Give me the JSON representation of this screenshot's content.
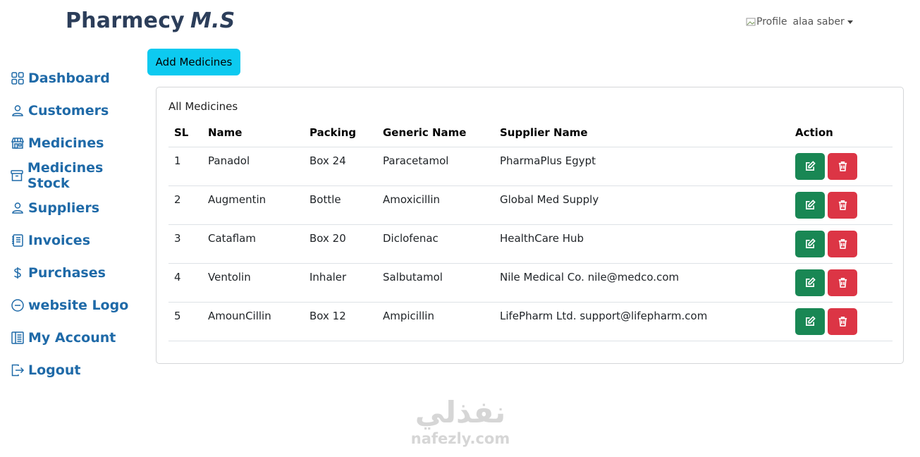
{
  "brand": {
    "name": "Pharmecy",
    "suffix": "M.S"
  },
  "profile": {
    "image_alt": "Profile",
    "username": "alaa saber"
  },
  "sidebar": {
    "items": [
      {
        "label": "Dashboard",
        "icon": "dashboard-grid-icon"
      },
      {
        "label": "Customers",
        "icon": "person-icon"
      },
      {
        "label": "Medicines",
        "icon": "shop-icon"
      },
      {
        "label": "Medicines Stock",
        "icon": "archive-icon"
      },
      {
        "label": "Suppliers",
        "icon": "person-icon"
      },
      {
        "label": "Invoices",
        "icon": "journal-icon"
      },
      {
        "label": "Purchases",
        "icon": "dollar-icon"
      },
      {
        "label": "website Logo",
        "icon": "dash-circle-icon"
      },
      {
        "label": "My Account",
        "icon": "layout-icon"
      },
      {
        "label": "Logout",
        "icon": "logout-icon"
      }
    ]
  },
  "toolbar": {
    "add_label": "Add Medicines"
  },
  "card": {
    "title": "All Medicines"
  },
  "table": {
    "headers": [
      "SL",
      "Name",
      "Packing",
      "Generic Name",
      "Supplier Name",
      "Action"
    ],
    "rows": [
      {
        "sl": "1",
        "name": "Panadol",
        "packing": "Box 24",
        "generic": "Paracetamol",
        "supplier": "PharmaPlus Egypt"
      },
      {
        "sl": "2",
        "name": "Augmentin",
        "packing": "Bottle",
        "generic": "Amoxicillin",
        "supplier": "Global Med Supply"
      },
      {
        "sl": "3",
        "name": "Cataflam",
        "packing": "Box 20",
        "generic": "Diclofenac",
        "supplier": "HealthCare Hub"
      },
      {
        "sl": "4",
        "name": "Ventolin",
        "packing": "Inhaler",
        "generic": "Salbutamol",
        "supplier": "Nile Medical Co. nile@medco.com"
      },
      {
        "sl": "5",
        "name": "AmounCillin",
        "packing": "Box 12",
        "generic": "Ampicillin",
        "supplier": "LifePharm Ltd. support@lifepharm.com"
      }
    ]
  },
  "colors": {
    "brand": "#2c3e5a",
    "nav": "#1f6aa8",
    "add_button": "#0dcaf0",
    "edit": "#198754",
    "delete": "#dc3545"
  },
  "watermark": {
    "arabic": "نفذلي",
    "latin": "nafezly.com"
  }
}
